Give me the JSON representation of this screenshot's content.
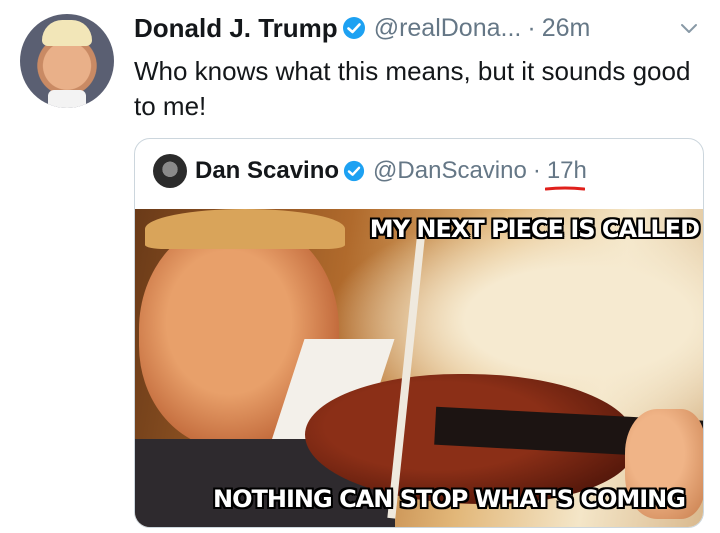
{
  "tweet": {
    "author_name": "Donald J. Trump",
    "author_handle": "@realDona...",
    "separator": "·",
    "time": "26m",
    "text": "Who knows what this means, but it sounds good to me!"
  },
  "quoted_tweet": {
    "author_name": "Dan Scavino",
    "author_handle": "@DanScavino",
    "separator": "·",
    "time": "17h",
    "image": {
      "caption_top": "MY NEXT PIECE IS CALLED",
      "caption_bottom": "NOTHING CAN STOP WHAT'S COMING"
    }
  },
  "icons": {
    "verified": "verified-badge-icon",
    "caret": "chevron-down-icon"
  },
  "colors": {
    "verified_blue": "#1da1f2",
    "secondary_text": "#657786",
    "annotation_red": "#e0201b"
  }
}
